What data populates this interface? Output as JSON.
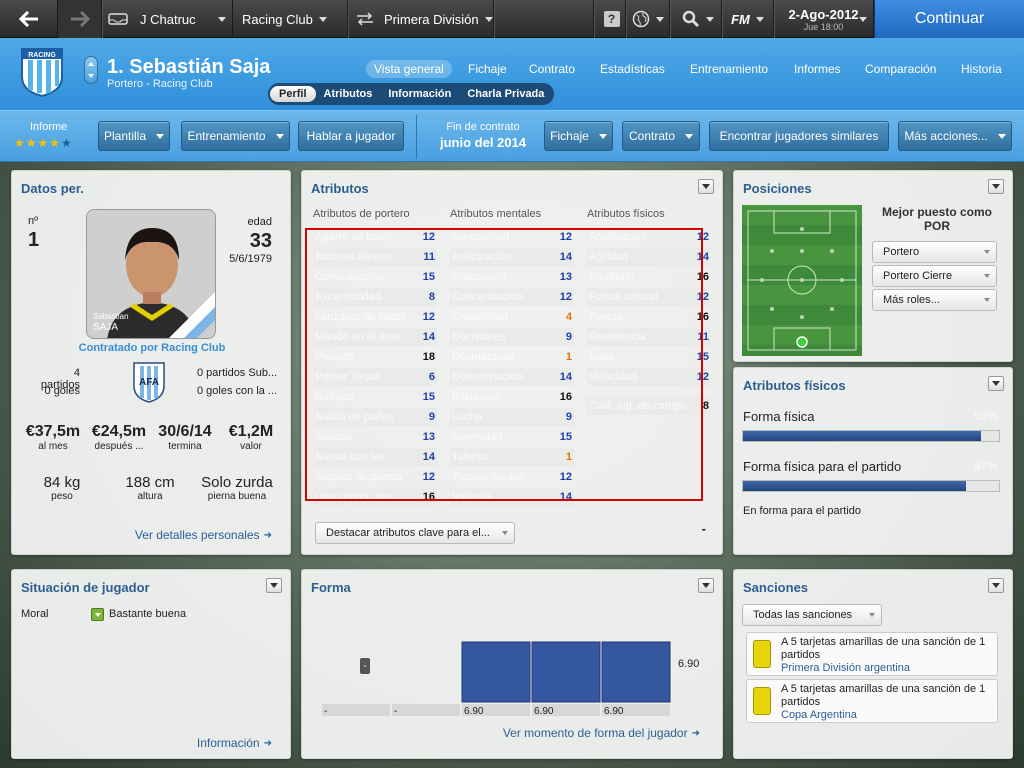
{
  "topbar": {
    "manager": "J Chatruc",
    "club": "Racing Club",
    "competition": "Primera División",
    "date": "2-Ago-2012",
    "time": "Jue 18:00",
    "continue": "Continuar",
    "fm_label": "FM"
  },
  "player": {
    "name": "1. Sebastián Saja",
    "subtitle": "Portero - Racing Club",
    "number_label": "nº",
    "number": "1",
    "age_label": "edad",
    "age": "33",
    "dob": "5/6/1979",
    "card_top": "Sebastian",
    "card_name": "SAJA",
    "contract_by": "Contratado por Racing Club"
  },
  "header_tabs": [
    "Vista general",
    "Fichaje",
    "Contrato",
    "Estadísticas",
    "Entrenamiento",
    "Informes",
    "Comparación",
    "Historia"
  ],
  "sub_tabs": [
    "Perfil",
    "Atributos",
    "Información",
    "Charla Privada"
  ],
  "toolbar": {
    "informe": "Informe",
    "rating": 3.5,
    "plantilla": "Plantilla",
    "entrenamiento": "Entrenamiento",
    "hablar": "Hablar a jugador",
    "fin_label": "Fin de contrato",
    "fin_value": "junio del 2014",
    "fichaje": "Fichaje",
    "contrato": "Contrato",
    "similares": "Encontrar jugadores similares",
    "mas": "Más acciones..."
  },
  "datos": {
    "title": "Datos per.",
    "left_stats": [
      "4 partidos",
      "0 goles"
    ],
    "right_stats": [
      "0 partidos Sub...",
      "0 goles con la ..."
    ],
    "money": [
      {
        "v": "€37,5m",
        "l": "al mes"
      },
      {
        "v": "€24,5m",
        "l": "después ..."
      },
      {
        "v": "30/6/14",
        "l": "termina"
      },
      {
        "v": "€1,2M",
        "l": "valor"
      }
    ],
    "body": [
      {
        "v": "84 kg",
        "l": "peso"
      },
      {
        "v": "188 cm",
        "l": "altura"
      },
      {
        "v": "Solo zurda",
        "l": "pierna buena"
      }
    ],
    "link": "Ver detalles personales"
  },
  "atributos": {
    "title": "Atributos",
    "headers": [
      "Atributos de portero",
      "Atributos mentales",
      "Atributos físicos"
    ],
    "gk": [
      [
        "Agarre de balón",
        "12",
        "b"
      ],
      [
        "Balones aéreos",
        "11",
        "b"
      ],
      [
        "Comunicación",
        "15",
        "b"
      ],
      [
        "Excentricidad",
        "8",
        "b"
      ],
      [
        "Lanzador de faltas",
        "12",
        "b"
      ],
      [
        "Mando en el área",
        "14",
        "b"
      ],
      [
        "Penaltis",
        "18",
        "k"
      ],
      [
        "Primer Toque",
        "6",
        "b"
      ],
      [
        "Reflejos",
        "15",
        "b"
      ],
      [
        "Salida de puños",
        "9",
        "b"
      ],
      [
        "Salidas",
        "13",
        "b"
      ],
      [
        "Saque con las...",
        "14",
        "b"
      ],
      [
        "Saques de puerta",
        "12",
        "b"
      ],
      [
        "Uno contra uno",
        "16",
        "k"
      ]
    ],
    "mental": [
      [
        "Agresividad",
        "12",
        "b"
      ],
      [
        "Anticipación",
        "14",
        "b"
      ],
      [
        "Colocación",
        "13",
        "b"
      ],
      [
        "Concentración",
        "12",
        "b"
      ],
      [
        "Creatividad",
        "4",
        "o"
      ],
      [
        "Decisiones",
        "9",
        "b"
      ],
      [
        "Desmarques",
        "1",
        "o"
      ],
      [
        "Determinación",
        "14",
        "b"
      ],
      [
        "Influencia",
        "16",
        "k"
      ],
      [
        "Lucha",
        "9",
        "b"
      ],
      [
        "Serenidad",
        "15",
        "b"
      ],
      [
        "Talento",
        "1",
        "o"
      ],
      [
        "Trabajo equipo",
        "12",
        "b"
      ],
      [
        "Valentía",
        "14",
        "b"
      ]
    ],
    "fisicos": [
      [
        "Aceleración",
        "12",
        "b"
      ],
      [
        "Agilidad",
        "14",
        "b"
      ],
      [
        "Equilibrio",
        "16",
        "k"
      ],
      [
        "Forma natural",
        "12",
        "b"
      ],
      [
        "Fuerza",
        "16",
        "k"
      ],
      [
        "Resistencia",
        "11",
        "b"
      ],
      [
        "Salto",
        "15",
        "b"
      ],
      [
        "Velocidad",
        "12",
        "b"
      ]
    ],
    "calif": [
      "Calif. jug. de campo",
      "8"
    ],
    "highlight": "Destacar atributos clave para el...",
    "dash": "-"
  },
  "posiciones": {
    "title": "Posiciones",
    "best_label": "Mejor puesto como",
    "best": "POR",
    "roles": [
      "Portero",
      "Portero Cierre",
      "Más roles..."
    ]
  },
  "fisicos_panel": {
    "title": "Atributos físicos",
    "forma": "Forma física",
    "forma_val": "93%",
    "forma_pct": 0.93,
    "partido": "Forma física para el partido",
    "partido_val": "87%",
    "partido_pct": 0.87,
    "status": "En forma para el partido"
  },
  "situacion": {
    "title": "Situación de jugador",
    "moral_label": "Moral",
    "moral": "Bastante buena",
    "link": "Información"
  },
  "forma": {
    "title": "Forma",
    "dash": "-",
    "value_label": "6.90",
    "cells": [
      "-",
      "-",
      "6.90",
      "6.90",
      "6.90"
    ],
    "bars": [
      0,
      0,
      6.9,
      6.9,
      6.9
    ],
    "link": "Ver momento de forma del jugador"
  },
  "sanciones": {
    "title": "Sanciones",
    "filter": "Todas las sanciones",
    "items": [
      {
        "text": "A 5 tarjetas amarillas de una sanción de 1 partidos",
        "comp": "Primera División argentina"
      },
      {
        "text": "A 5 tarjetas amarillas de una sanción de 1 partidos",
        "comp": "Copa Argentina"
      }
    ]
  },
  "colors": {
    "header": "#3a9ae0",
    "continue": "#2a78d0",
    "accent": "#2d5e92",
    "highlight_box": "#d40000",
    "card": "#e7d40a"
  }
}
